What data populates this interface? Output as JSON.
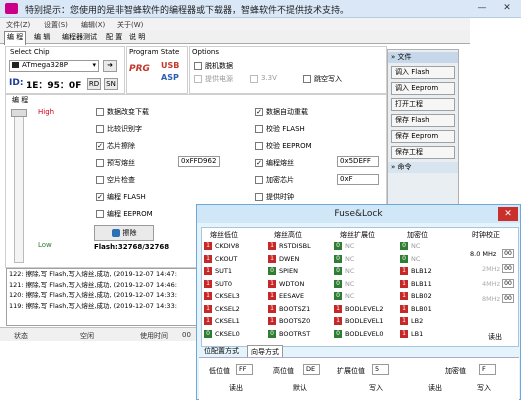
{
  "window": {
    "title": "特别提示：您使用的是非智蜂软件的编程器或下载器，智蜂软件不提供技术支持。"
  },
  "menu": [
    "文件(Z)",
    "设置(S)",
    "编辑(X)",
    "关于(W)"
  ],
  "tabs": [
    "编 程",
    "编 辑",
    "编程器测试",
    "配 置",
    "说 明"
  ],
  "chip": {
    "label": "Select Chip",
    "value": "ATmega328P",
    "id_label": "ID:",
    "id_value": "1E：95：0F",
    "rd": "RD",
    "sn": "SN"
  },
  "program_state": {
    "label": "Program State",
    "prg": "PRG",
    "usb": "USB",
    "asp": "ASP"
  },
  "options": {
    "label": "Options",
    "items": [
      "脱机数据",
      "提供电源",
      "3.3V",
      "跳空写入"
    ]
  },
  "editor": {
    "label": "编 程",
    "high": "High",
    "low": "Low"
  },
  "checks_left": [
    {
      "label": "数据改变下载",
      "on": false
    },
    {
      "label": "比较识别字",
      "on": false
    },
    {
      "label": "芯片擦除",
      "on": true
    },
    {
      "label": "预写熔丝",
      "on": false
    },
    {
      "label": "空片检查",
      "on": false
    },
    {
      "label": "编程 FLASH",
      "on": true
    },
    {
      "label": "编程 EEPROM",
      "on": false
    }
  ],
  "checks_right": [
    {
      "label": "数据自动重载",
      "on": true
    },
    {
      "label": "校验 FLASH",
      "on": false
    },
    {
      "label": "校验 EEPROM",
      "on": false
    },
    {
      "label": "编程熔丝",
      "on": true
    },
    {
      "label": "加密芯片",
      "on": false
    },
    {
      "label": "提供时钟",
      "on": false
    }
  ],
  "fuse_prewrite": "0xFFD962",
  "fuse_program": "0x5DEFF",
  "lock_value": "0xF",
  "erase_button": "擦除",
  "flash_info": "Flash:32768/32768",
  "sidebar": {
    "file_header": "文件",
    "buttons": [
      "调入 Flash",
      "调入 Eeprom",
      "打开工程",
      "保存 Flash",
      "保存 Eeprom",
      "保存工程"
    ],
    "cmd_header": "命令"
  },
  "log": [
    "122: 擦除,写 Flash,写入熔丝,成功, (2019-12-07 14:47:",
    "121: 擦除,写 Flash,写入熔丝,成功, (2019-12-07 14:46:",
    "120: 擦除,写 Flash,写入熔丝,成功, (2019-12-07 14:33:",
    "119: 擦除,写 Flash,写入熔丝,成功, (2019-12-07 14:33:"
  ],
  "status": {
    "state_label": "状态",
    "state_value": "空闲",
    "time_label": "使用时间",
    "time_value": "00"
  },
  "fuse": {
    "title": "Fuse&Lock",
    "close": "✕",
    "headers": [
      "熔丝低位",
      "熔丝高位",
      "熔丝扩展位",
      "加密位",
      "时钟校正"
    ],
    "low": [
      {
        "bit": "1",
        "name": "CKDIV8"
      },
      {
        "bit": "1",
        "name": "CKOUT"
      },
      {
        "bit": "1",
        "name": "SUT1"
      },
      {
        "bit": "1",
        "name": "SUT0"
      },
      {
        "bit": "1",
        "name": "CKSEL3"
      },
      {
        "bit": "1",
        "name": "CKSEL2"
      },
      {
        "bit": "1",
        "name": "CKSEL1"
      },
      {
        "bit": "0",
        "name": "CKSEL0"
      }
    ],
    "high": [
      {
        "bit": "1",
        "name": "RSTDISBL"
      },
      {
        "bit": "1",
        "name": "DWEN"
      },
      {
        "bit": "0",
        "name": "SPIEN"
      },
      {
        "bit": "1",
        "name": "WDTON"
      },
      {
        "bit": "1",
        "name": "EESAVE"
      },
      {
        "bit": "1",
        "name": "BOOTSZ1"
      },
      {
        "bit": "1",
        "name": "BOOTSZ0"
      },
      {
        "bit": "0",
        "name": "BOOTRST"
      }
    ],
    "ext": [
      {
        "bit": "0",
        "name": "NC"
      },
      {
        "bit": "0",
        "name": "NC"
      },
      {
        "bit": "0",
        "name": "NC"
      },
      {
        "bit": "0",
        "name": "NC"
      },
      {
        "bit": "0",
        "name": "NC"
      },
      {
        "bit": "1",
        "name": "BODLEVEL2"
      },
      {
        "bit": "1",
        "name": "BODLEVEL1"
      },
      {
        "bit": "0",
        "name": "BODLEVEL0"
      }
    ],
    "lock": [
      {
        "bit": "0",
        "name": "NC"
      },
      {
        "bit": "0",
        "name": "NC"
      },
      {
        "bit": "1",
        "name": "BLB12"
      },
      {
        "bit": "1",
        "name": "BLB11"
      },
      {
        "bit": "1",
        "name": "BLB02"
      },
      {
        "bit": "1",
        "name": "BLB01"
      },
      {
        "bit": "1",
        "name": "LB2"
      },
      {
        "bit": "1",
        "name": "LB1"
      }
    ],
    "clock": [
      {
        "label": "8.0 MHz",
        "value": "00"
      },
      {
        "label": "2MHz",
        "value": "00"
      },
      {
        "label": "4MHz",
        "value": "00"
      },
      {
        "label": "8MHz",
        "value": "00"
      }
    ],
    "clock_read": "读出",
    "tabs": [
      "位配置方式",
      "向导方式"
    ],
    "low_label": "低位值",
    "low_value": "FF",
    "high_label": "高位值",
    "high_value": "DE",
    "ext_label": "扩展位值",
    "ext_value": "5",
    "lock_label": "加密值",
    "lock_value": "F",
    "read": "读出",
    "default": "默认",
    "write": "写入",
    "read2": "读出",
    "write2": "写入"
  }
}
